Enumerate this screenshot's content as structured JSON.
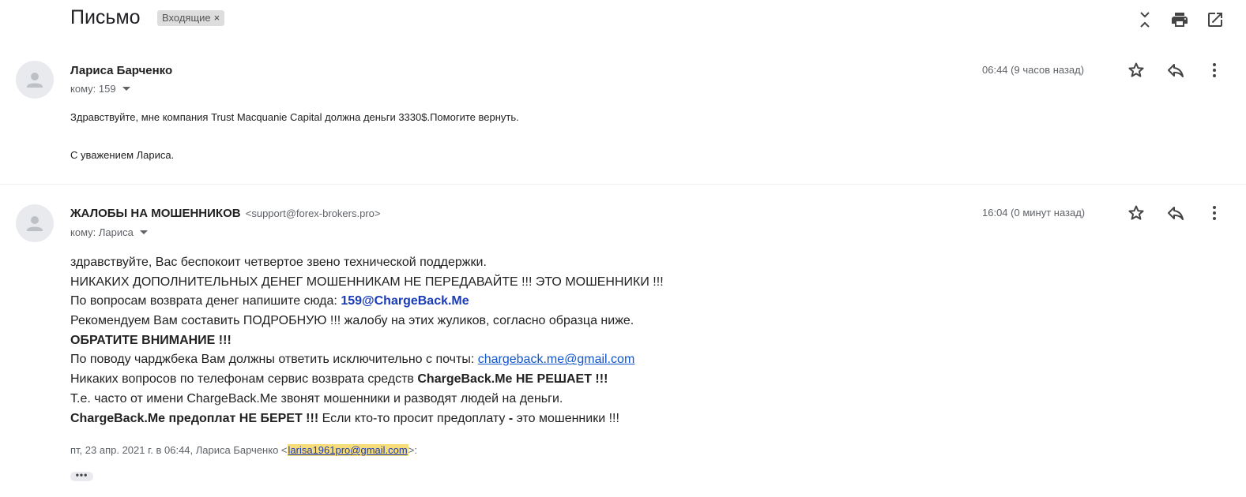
{
  "header": {
    "subject": "Письмо",
    "label": "Входящие",
    "label_remove": "×",
    "icons": [
      "expand-collapse-icon",
      "print-icon",
      "open-in-new-window-icon"
    ]
  },
  "messages": [
    {
      "sender_name": "Лариса Барченко",
      "sender_email": "",
      "to_line": "кому: 159",
      "time": "06:44 (9 часов назад)",
      "body": [
        "Здравствуйте, мне компания Trust Macquanie Capital должна деньги 3330$.Помогите  вернуть.",
        "С уважением Лариса."
      ]
    },
    {
      "sender_name": "ЖАЛОБЫ НА МОШЕННИКОВ",
      "sender_email": "<support@forex-brokers.pro>",
      "to_line": "кому: Лариса",
      "time": "16:04 (0 минут назад)",
      "body": {
        "l1": "здравствуйте, Вас беспокоит четвертое звено технической поддержки.",
        "l2": "НИКАКИХ ДОПОЛНИТЕЛЬНЫХ ДЕНЕГ МОШЕННИКАМ НЕ ПЕРЕДАВАЙТЕ !!! ЭТО МОШЕННИКИ !!!",
        "l3_text": "По вопросам возврата денег напишите сюда: ",
        "l3_email": "159@ChargeBack.Me",
        "l4": "Рекомендуем Вам составить ПОДРОБНУЮ !!! жалобу на этих жуликов, согласно образца ниже.",
        "l5": "ОБРАТИТЕ ВНИМАНИЕ !!!",
        "l6_text": "По поводу чарджбека Вам должны ответить исключительно с почты: ",
        "l6_link": "chargeback.me@gmail.com",
        "l7_text": "Никаких вопросов по телефонам сервис возврата средств ",
        "l7_bold": "ChargeBack.Me НЕ РЕШАЕТ !!!",
        "l8": "Т.е. часто от имени ChargeBack.Me звонят мошенники и разводят людей на деньги.",
        "l9_bold": "ChargeBack.Me предоплат НЕ БЕРЕТ !!!",
        "l9_text": " Если кто-то просит предоплату ",
        "l9_dash": "-",
        "l9_end": " это мошенники !!!"
      },
      "quote": {
        "prefix": "пт, 23 апр. 2021 г. в 06:44, Лариса Барченко <",
        "email": "larisa1961pro@gmail.com",
        "suffix": ">:"
      },
      "show_trimmed": "•••"
    }
  ],
  "colors": {
    "link": "#1155cc",
    "blue_bold": "#1a3bb8",
    "highlight": "#f7dc7a",
    "label_bg": "#dddddd"
  }
}
